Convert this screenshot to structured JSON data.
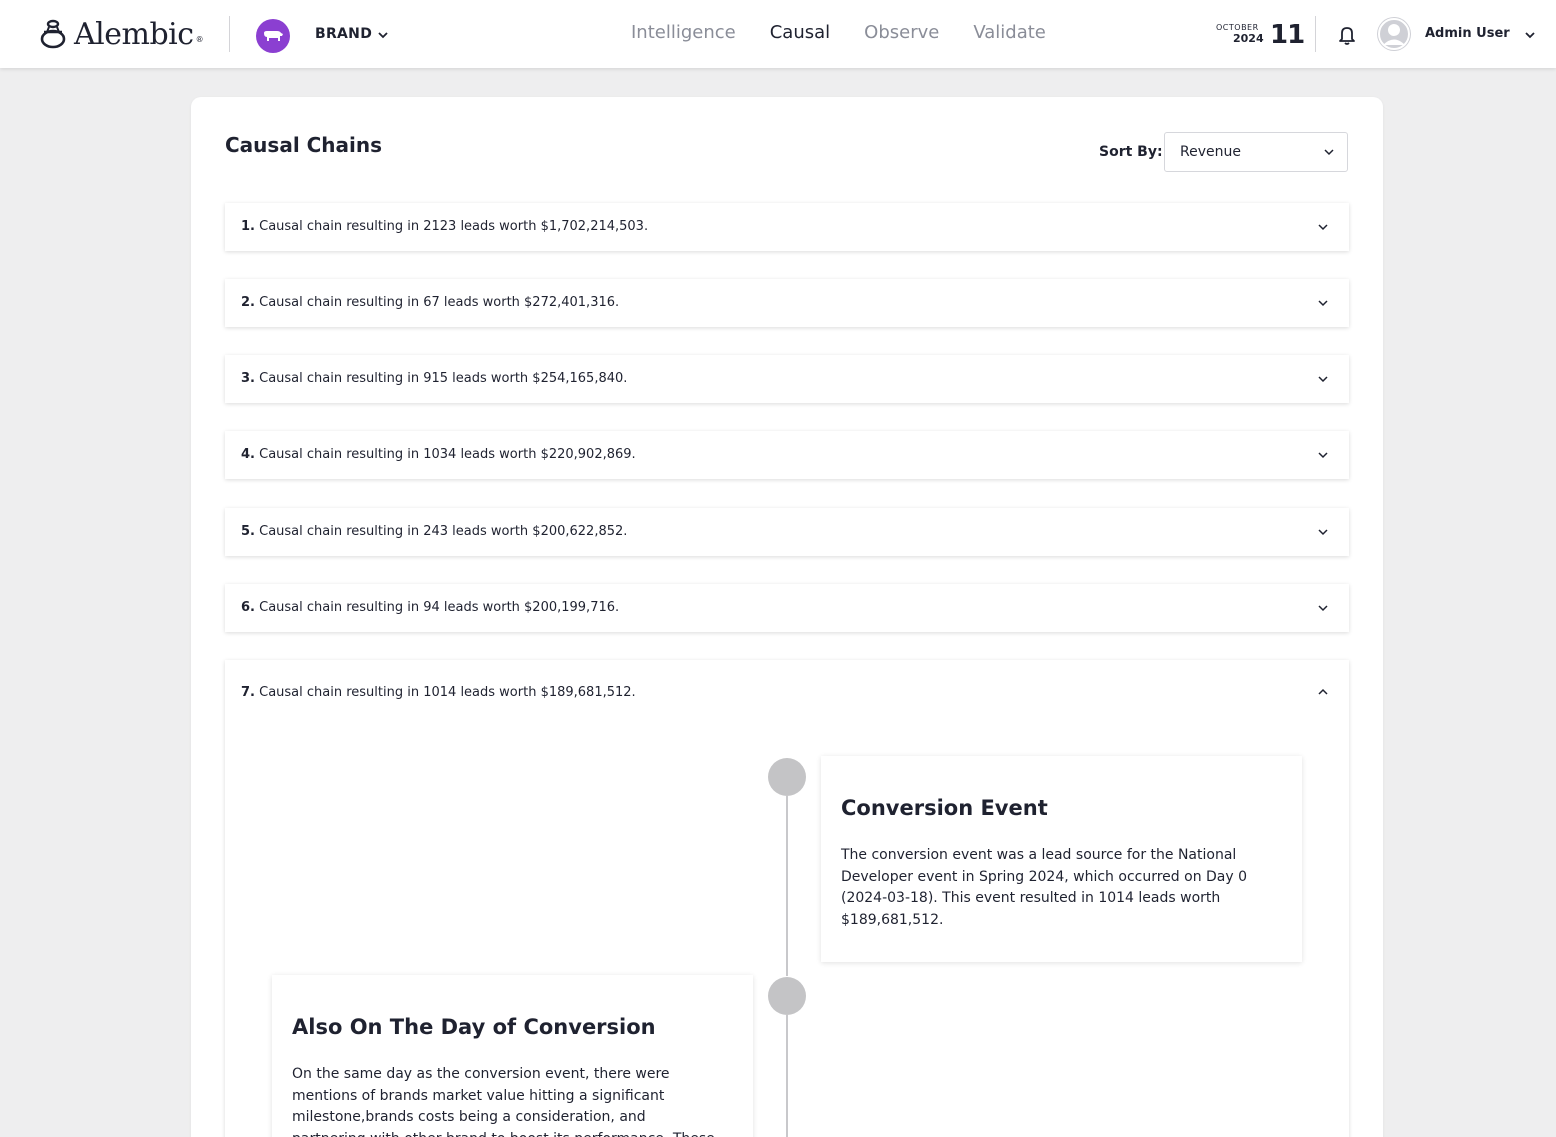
{
  "header": {
    "logo_text": "Alembic",
    "logo_reg": "®",
    "brand_label": "BRAND",
    "nav_tabs": [
      {
        "label": "Intelligence",
        "active": false
      },
      {
        "label": "Causal",
        "active": true
      },
      {
        "label": "Observe",
        "active": false
      },
      {
        "label": "Validate",
        "active": false
      }
    ],
    "date": {
      "month": "OCTOBER",
      "year": "2024",
      "day": "11"
    },
    "user_name": "Admin User",
    "accent_color": "#8b3fd1"
  },
  "main": {
    "title": "Causal Chains",
    "sort_label": "Sort By:",
    "sort_value": "Revenue",
    "chains": [
      {
        "num": "1.",
        "text": "Causal chain resulting in 2123 leads worth $1,702,214,503.",
        "expanded": false
      },
      {
        "num": "2.",
        "text": "Causal chain resulting in 67 leads worth $272,401,316.",
        "expanded": false
      },
      {
        "num": "3.",
        "text": "Causal chain resulting in 915 leads worth $254,165,840.",
        "expanded": false
      },
      {
        "num": "4.",
        "text": "Causal chain resulting in 1034 leads worth $220,902,869.",
        "expanded": false
      },
      {
        "num": "5.",
        "text": "Causal chain resulting in 243 leads worth $200,622,852.",
        "expanded": false
      },
      {
        "num": "6.",
        "text": "Causal chain resulting in 94 leads worth $200,199,716.",
        "expanded": false
      },
      {
        "num": "7.",
        "text": "Causal chain resulting in 1014 leads worth $189,681,512.",
        "expanded": true
      }
    ],
    "timeline": [
      {
        "title": "Conversion Event",
        "body": "The conversion event was a lead source for the National Developer event in Spring 2024, which occurred on Day 0 (2024-03-18). This event resulted in 1014 leads worth $189,681,512."
      },
      {
        "title": "Also On The Day of Conversion",
        "body": "On the same day as the conversion event, there were mentions of brands market value hitting a significant milestone,brands costs being a consideration, and partnering with other brand to boost its performance. These"
      }
    ]
  }
}
